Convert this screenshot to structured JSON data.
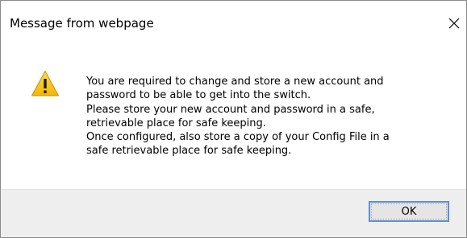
{
  "window": {
    "title": "Message from webpage"
  },
  "icons": {
    "close": "close-icon",
    "warning": "warning-icon"
  },
  "message": {
    "lines": [
      "You are required to change and store a new account and",
      "password to be able to get into the switch.",
      "Please store your new account and password in a safe,",
      "retrievable place for safe keeping.",
      "Once configured, also store a copy of your Config File in a",
      "safe retrievable place for safe keeping."
    ]
  },
  "buttons": {
    "ok_label": "OK"
  },
  "colors": {
    "warning_fill": "#f6c51e",
    "warning_mark": "#1a1a1a",
    "button_focus_border": "#5d8fd6",
    "footer_background": "#eeeeee"
  }
}
